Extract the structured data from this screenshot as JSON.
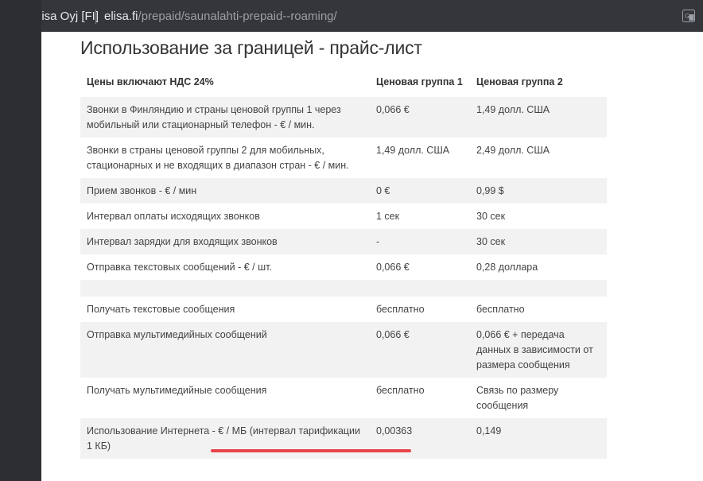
{
  "browser": {
    "site_name": "Elisa Oyj [FI]",
    "url_domain": "elisa.fi",
    "url_path": "/prepaid/saunalahti-prepaid--roaming/"
  },
  "page": {
    "title": "Использование за границей - прайс-лист"
  },
  "table": {
    "headers": [
      "Цены включают НДС 24%",
      "Ценовая группа 1",
      "Ценовая группа 2"
    ],
    "rows": [
      [
        "Звонки в Финляндию и страны ценовой группы 1 через мобильный или стационарный телефон - € / мин.",
        "0,066 €",
        "1,49 долл. США"
      ],
      [
        "Звонки в страны ценовой группы 2 для мобильных, стационарных и не входящих в диапазон стран - € / мин.",
        "1,49 долл. США",
        "2,49 долл. США"
      ],
      [
        "Прием звонков - € / мин",
        "0 €",
        "0,99 $"
      ],
      [
        "Интервал оплаты исходящих звонков",
        "1 сек",
        "30 сек"
      ],
      [
        "Интервал зарядки для входящих звонков",
        "-",
        "30 сек"
      ],
      [
        "Отправка текстовых сообщений - € / шт.",
        "0,066 €",
        "0,28 доллара"
      ],
      [
        "",
        "",
        ""
      ],
      [
        "Получать текстовые сообщения",
        "бесплатно",
        "бесплатно"
      ],
      [
        "Отправка мультимедийных сообщений",
        "0,066 €",
        "0,066 € + передача данных в зависимости от размера сообщения"
      ],
      [
        "Получать мультимедийные сообщения",
        "бесплатно",
        "Связь по размеру сообщения"
      ],
      [
        "Использование Интернета - € / МБ (интервал тарификации 1 КБ)",
        "0,00363",
        "0,149"
      ]
    ]
  },
  "colors": {
    "highlight_underline": "#e8454d",
    "row_alt": "#f2f2f2"
  }
}
